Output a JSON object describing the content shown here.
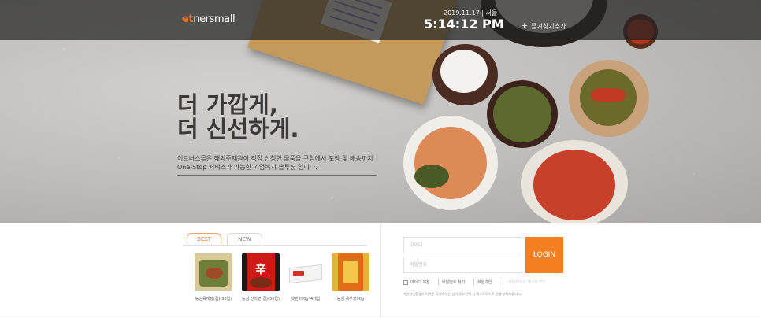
{
  "header": {
    "logo_prefix": "et",
    "logo_rest": "nersmall",
    "date": "2019.11.17 | 서울",
    "time": "5:14:12 PM",
    "bookmark_label": "즐겨찾기추가"
  },
  "hero": {
    "headline_line1": "더 가깝게,",
    "headline_line2": "더 신선하게.",
    "desc_line1": "이트너스몰은 해외주재원이 직접 신청한 물품을 구입에서 포장 및 배송까지",
    "desc_line2": "One-Stop 서비스가 가능한 기업복지 솔루션 입니다."
  },
  "products": {
    "tabs": [
      "BEST",
      "NEW"
    ],
    "active_tab": "BEST",
    "items": [
      {
        "name": "농심육개장(컵)(30입)",
        "icon": "yukgaejang-cup-icon"
      },
      {
        "name": "농심 신라면(컵)(30입)",
        "icon": "shin-ramyun-cup-icon"
      },
      {
        "name": "햇반200g*4개입",
        "icon": "hetbahn-rice-icon"
      },
      {
        "name": "농심 새우깡90g",
        "icon": "saeukkang-snack-icon"
      }
    ]
  },
  "login": {
    "id_placeholder": "아이디",
    "pw_placeholder": "비밀번호",
    "login_label": "LOGIN",
    "save_id_label": "아이디 저장",
    "find_pw_label": "비밀번호 찾기",
    "signup_label": "회원가입",
    "faint_text": "아이지오드 텍스트코드",
    "notice": "※인터넷환경이 어려운 국가에서는 상기 로드선택 시 텍스트모드로 진행 부탁드립니다."
  },
  "colors": {
    "accent": "#f58021",
    "topbar": "#232323",
    "headline": "#3a3a3a"
  }
}
